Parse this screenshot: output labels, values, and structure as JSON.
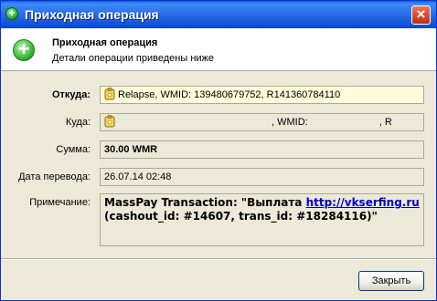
{
  "window": {
    "title": "Приходная операция"
  },
  "header": {
    "title": "Приходная операция",
    "subtitle": "Детали операции приведены ниже"
  },
  "fields": {
    "from": {
      "label": "Откуда:",
      "value": "Relapse, WMID: 139480679752, R141360784110"
    },
    "to": {
      "label": "Куда:",
      "wmid_label": ", WMID:",
      "suffix": ", R"
    },
    "amount": {
      "label": "Сумма:",
      "value": "30.00 WMR"
    },
    "date": {
      "label": "Дата перевода:",
      "value": "26.07.14 02:48"
    },
    "note": {
      "label": "Примечание:",
      "prefix": "MassPay Transaction: \"Выплата ",
      "link": "http://vkserfing.ru",
      "suffix": "(cashout_id: #14607, trans_id: #18284116)\""
    }
  },
  "buttons": {
    "close": "Закрыть"
  },
  "colors": {
    "titlebar": "#2c6fea",
    "link": "#0000cc",
    "highlight_field": "#fffad9"
  },
  "icons": {
    "title": "add-circle-icon",
    "header": "add-circle-icon",
    "wallet": "webmoney-wallet-icon",
    "close": "close-icon"
  }
}
